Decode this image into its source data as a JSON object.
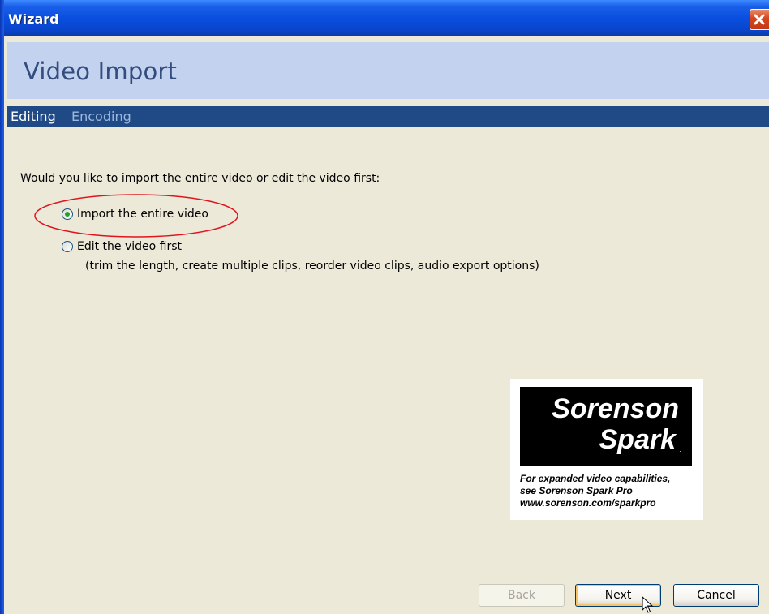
{
  "window": {
    "title": "Wizard"
  },
  "header": {
    "title": "Video Import"
  },
  "steps": [
    {
      "label": "Editing",
      "active": true
    },
    {
      "label": "Encoding",
      "active": false
    }
  ],
  "question": "Would you like to import the entire video or edit the video first:",
  "options": [
    {
      "label": "Import the entire video",
      "selected": true
    },
    {
      "label": "Edit the video first",
      "selected": false,
      "note": "(trim the length, create multiple clips, reorder video clips, audio export options)"
    }
  ],
  "logo": {
    "line1": "Sorenson",
    "line2": "Spark",
    "promo": [
      "For expanded video capabilities,",
      "see Sorenson Spark Pro",
      "www.sorenson.com/sparkpro"
    ]
  },
  "buttons": {
    "back": "Back",
    "next": "Next",
    "cancel": "Cancel"
  },
  "colors": {
    "titlebar": "#0a4ee0",
    "header_band": "#c3d2ee",
    "steps_bar": "#1f4a86",
    "dialog_bg": "#ECE9D8",
    "highlight": "#e0141e"
  },
  "icons": {
    "close": "close-icon",
    "cursor": "mouse-pointer-icon"
  }
}
